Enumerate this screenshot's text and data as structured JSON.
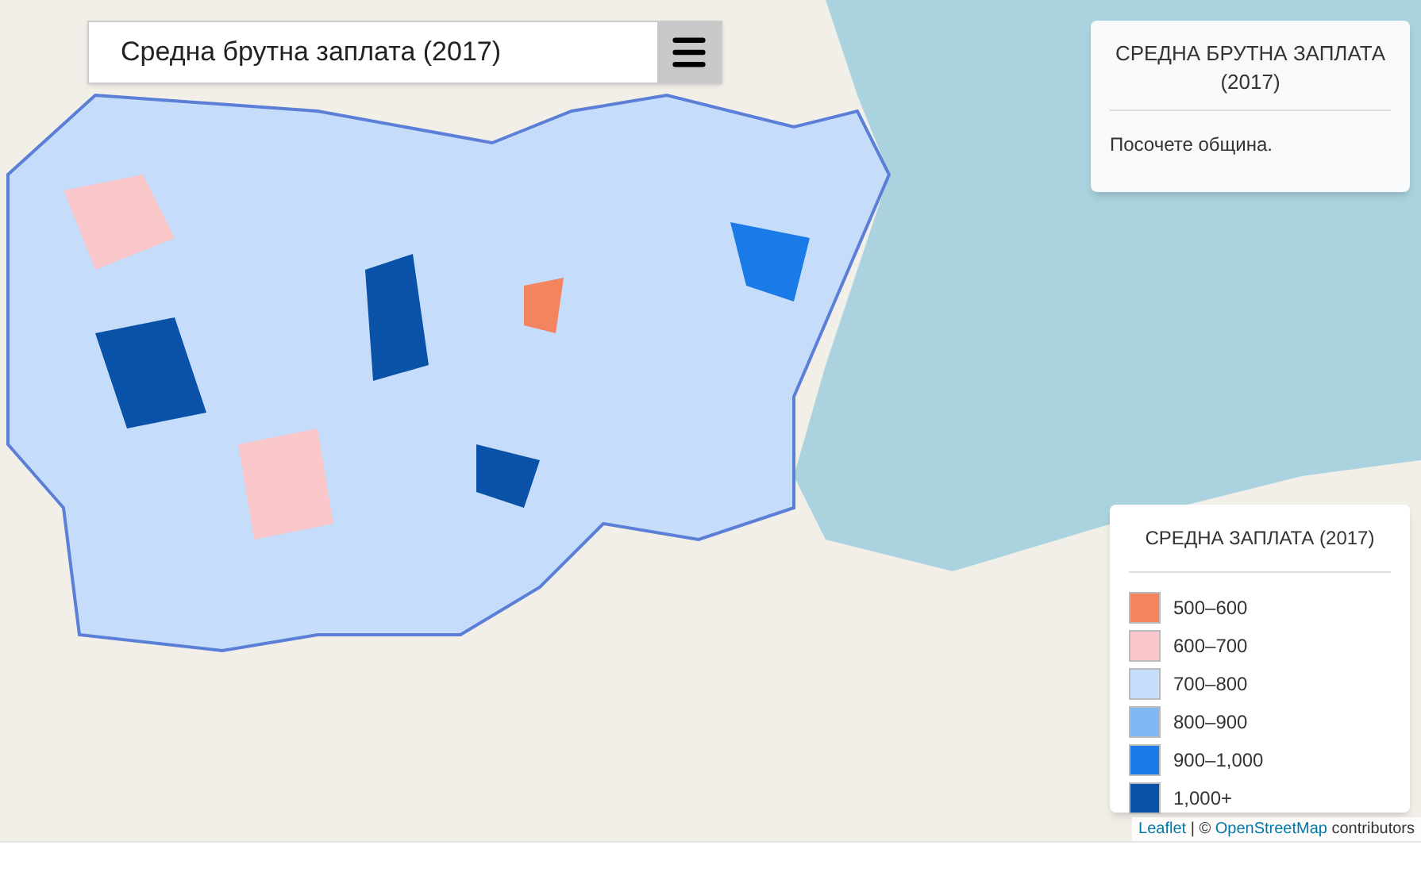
{
  "search": {
    "value": "Средна брутна заплата (2017)"
  },
  "info_panel": {
    "title": "СРЕДНА БРУТНА ЗАПЛАТА (2017)",
    "message": "Посочете община."
  },
  "legend": {
    "title": "СРЕДНА ЗАПЛАТА (2017)",
    "items": [
      {
        "label": "500–600",
        "color": "#f4845f"
      },
      {
        "label": "600–700",
        "color": "#f9c6c9"
      },
      {
        "label": "700–800",
        "color": "#c6dcfb"
      },
      {
        "label": "800–900",
        "color": "#7fb8f5"
      },
      {
        "label": "900–1,000",
        "color": "#1a7be8"
      },
      {
        "label": "1,000+",
        "color": "#0a52a8"
      }
    ]
  },
  "attribution": {
    "leaflet": "Leaflet",
    "separator": "| ©",
    "osm": "OpenStreetMap",
    "suffix": "contributors"
  }
}
